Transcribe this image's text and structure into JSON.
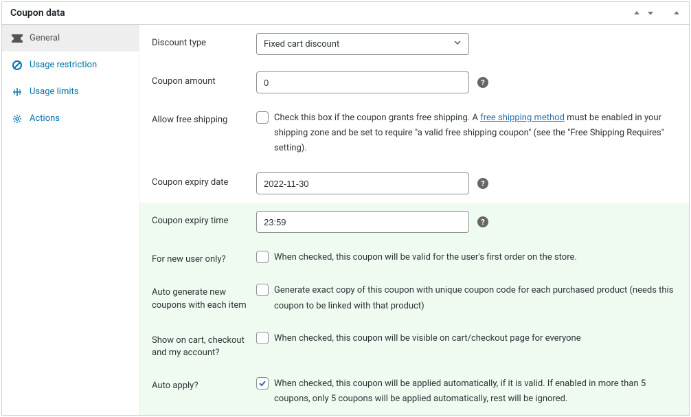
{
  "panel": {
    "title": "Coupon data"
  },
  "sidebar": {
    "items": [
      {
        "label": "General"
      },
      {
        "label": "Usage restriction"
      },
      {
        "label": "Usage limits"
      },
      {
        "label": "Actions"
      }
    ]
  },
  "fields": {
    "discount_type": {
      "label": "Discount type",
      "value": "Fixed cart discount"
    },
    "coupon_amount": {
      "label": "Coupon amount",
      "value": "0"
    },
    "free_shipping": {
      "label": "Allow free shipping",
      "desc_prefix": "Check this box if the coupon grants free shipping. A ",
      "link_text": "free shipping method",
      "desc_suffix": " must be enabled in your shipping zone and be set to require \"a valid free shipping coupon\" (see the \"Free Shipping Requires\" setting)."
    },
    "expiry_date": {
      "label": "Coupon expiry date",
      "value": "2022-11-30"
    },
    "expiry_time": {
      "label": "Coupon expiry time",
      "value": "23:59"
    },
    "new_user": {
      "label": "For new user only?",
      "desc": "When checked, this coupon will be valid for the user's first order on the store."
    },
    "auto_gen": {
      "label": "Auto generate new coupons with each item",
      "desc": "Generate exact copy of this coupon with unique coupon code for each purchased product (needs this coupon to be linked with that product)"
    },
    "show_cart": {
      "label": "Show on cart, checkout and my account?",
      "desc": "When checked, this coupon will be visible on cart/checkout page for everyone"
    },
    "auto_apply": {
      "label": "Auto apply?",
      "checked": true,
      "desc": "When checked, this coupon will be applied automatically, if it is valid. If enabled in more than 5 coupons, only 5 coupons will be applied automatically, rest will be ignored."
    }
  },
  "help_glyph": "?"
}
